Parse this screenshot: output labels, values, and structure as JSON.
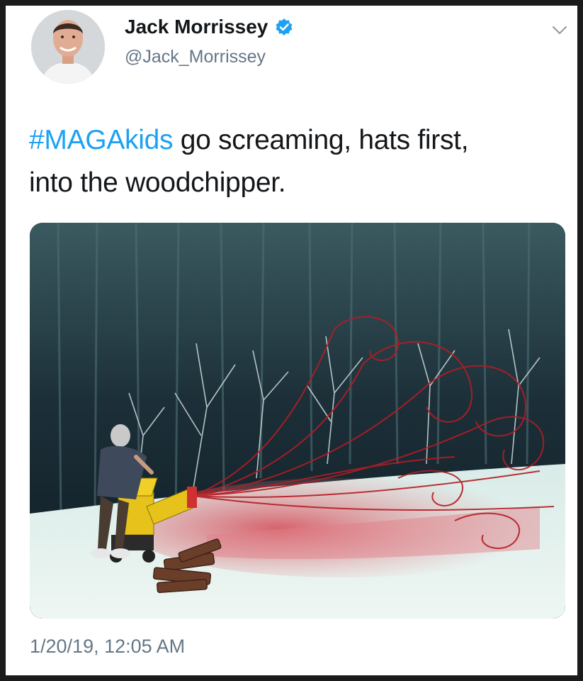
{
  "tweet": {
    "author_name": "Jack Morrissey",
    "handle": "@Jack_Morrissey",
    "verified": true,
    "text_hashtag": "#MAGAkids",
    "text_rest_line1": " go screaming, hats first,",
    "text_line2": "into the woodchipper.",
    "timestamp": "1/20/19, 12:05 AM"
  },
  "colors": {
    "hashtag": "#1da1f2",
    "verified_badge": "#1da1f2",
    "secondary_text": "#657786",
    "primary_text": "#14171a"
  },
  "icons": {
    "verified": "verified-badge-icon",
    "menu": "chevron-down-icon"
  }
}
